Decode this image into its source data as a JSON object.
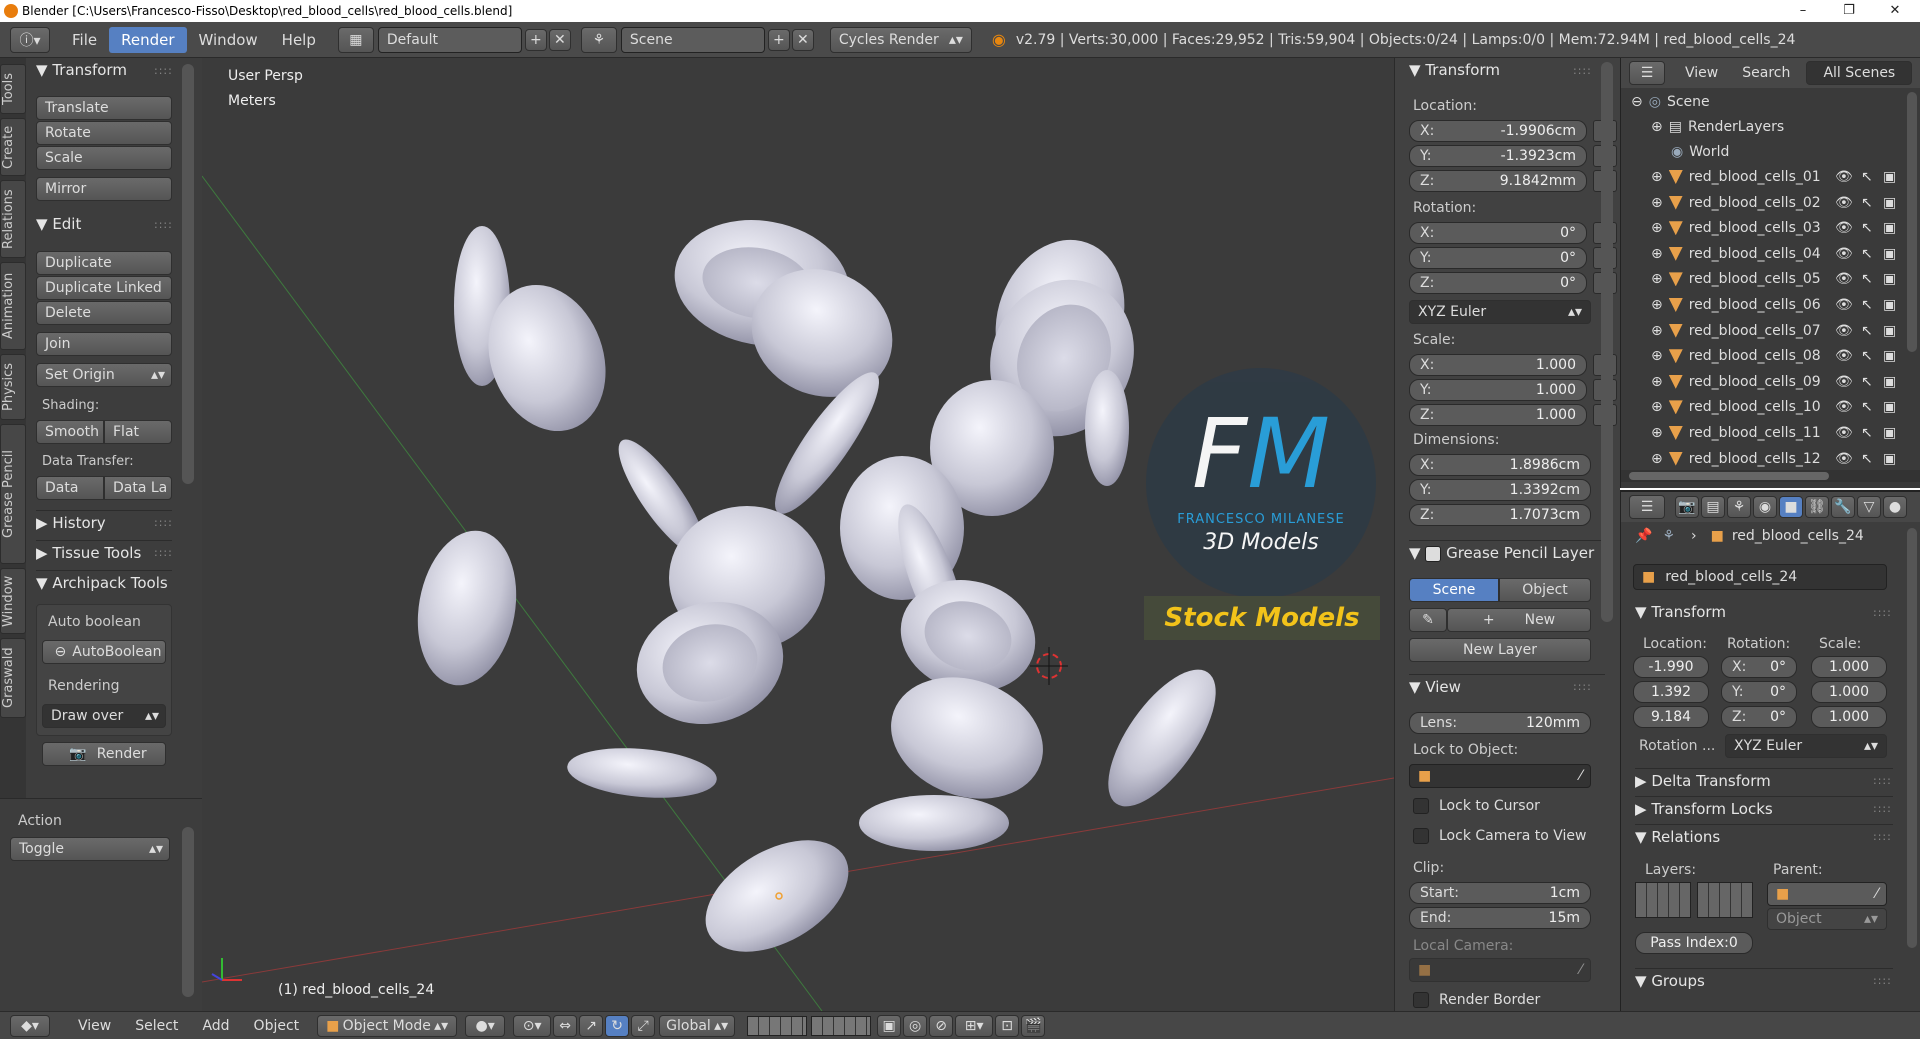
{
  "window": {
    "title": "Blender [C:\\Users\\Francesco-Fisso\\Desktop\\red_blood_cells\\red_blood_cells.blend]",
    "minimize": "–",
    "maximize": "❐",
    "close": "✕"
  },
  "topbar": {
    "menus": [
      "File",
      "Render",
      "Window",
      "Help"
    ],
    "active_menu": "Render",
    "layout": "Default",
    "scene": "Scene",
    "engine": "Cycles Render",
    "stats": "v2.79 | Verts:30,000 | Faces:29,952 | Tris:59,904 | Objects:0/24 | Lamps:0/0 | Mem:72.94M | red_blood_cells_24"
  },
  "left_tabs": [
    "Tools",
    "Create",
    "Relations",
    "Animation",
    "Physics",
    "Grease Pencil",
    "Window",
    "Graswald"
  ],
  "tools": {
    "transform_header": "Transform",
    "translate": "Translate",
    "rotate": "Rotate",
    "scale": "Scale",
    "mirror": "Mirror",
    "edit_header": "Edit",
    "duplicate": "Duplicate",
    "duplicate_linked": "Duplicate Linked",
    "delete": "Delete",
    "join": "Join",
    "set_origin": "Set Origin",
    "shading_label": "Shading:",
    "smooth": "Smooth",
    "flat": "Flat",
    "data_transfer_label": "Data Transfer:",
    "data": "Data",
    "data_la": "Data La",
    "history": "History",
    "tissue_tools": "Tissue Tools",
    "archipack": "Archipack Tools",
    "auto_boolean_label": "Auto boolean",
    "auto_boolean_btn": "AutoBoolean",
    "rendering_label": "Rendering",
    "draw_over": "Draw over",
    "render_btn": "Render",
    "action_label": "Action",
    "toggle": "Toggle"
  },
  "viewport": {
    "view_name": "User Persp",
    "units": "Meters",
    "selected": "(1) red_blood_cells_24",
    "logo_main": "FM",
    "logo_sub": "FRANCESCO MILANESE",
    "logo_models": "3D Models",
    "stock": "Stock Models"
  },
  "npanel": {
    "transform": "Transform",
    "location": "Location:",
    "loc": [
      {
        "a": "X:",
        "v": "-1.9906cm"
      },
      {
        "a": "Y:",
        "v": "-1.3923cm"
      },
      {
        "a": "Z:",
        "v": "9.1842mm"
      }
    ],
    "rotation": "Rotation:",
    "rot": [
      {
        "a": "X:",
        "v": "0°"
      },
      {
        "a": "Y:",
        "v": "0°"
      },
      {
        "a": "Z:",
        "v": "0°"
      }
    ],
    "rot_mode": "XYZ Euler",
    "scale": "Scale:",
    "scl": [
      {
        "a": "X:",
        "v": "1.000"
      },
      {
        "a": "Y:",
        "v": "1.000"
      },
      {
        "a": "Z:",
        "v": "1.000"
      }
    ],
    "dimensions": "Dimensions:",
    "dim": [
      {
        "a": "X:",
        "v": "1.8986cm"
      },
      {
        "a": "Y:",
        "v": "1.3392cm"
      },
      {
        "a": "Z:",
        "v": "1.7073cm"
      }
    ],
    "gp_layer": "Grease Pencil Layer",
    "gp_scene": "Scene",
    "gp_object": "Object",
    "gp_new": "New",
    "gp_new_layer": "New Layer",
    "view": "View",
    "lens_label": "Lens:",
    "lens_value": "120mm",
    "lock_object": "Lock to Object:",
    "lock_cursor": "Lock to Cursor",
    "lock_camera": "Lock Camera to View",
    "clip": "Clip:",
    "clip_start_label": "Start:",
    "clip_start": "1cm",
    "clip_end_label": "End:",
    "clip_end": "15m",
    "local_camera": "Local Camera:",
    "render_border": "Render Border"
  },
  "outliner": {
    "view": "View",
    "search": "Search",
    "filter": "All Scenes",
    "scene": "Scene",
    "render_layers": "RenderLayers",
    "world": "World",
    "objects": [
      "red_blood_cells_01",
      "red_blood_cells_02",
      "red_blood_cells_03",
      "red_blood_cells_04",
      "red_blood_cells_05",
      "red_blood_cells_06",
      "red_blood_cells_07",
      "red_blood_cells_08",
      "red_blood_cells_09",
      "red_blood_cells_10",
      "red_blood_cells_11",
      "red_blood_cells_12"
    ]
  },
  "properties": {
    "breadcrumb": "red_blood_cells_24",
    "object_name": "red_blood_cells_24",
    "transform": "Transform",
    "location": "Location:",
    "rotation": "Rotation:",
    "scale": "Scale:",
    "loc": [
      "-1.990",
      "1.392",
      "9.184"
    ],
    "rot": [
      {
        "a": "X:",
        "v": "0°"
      },
      {
        "a": "Y:",
        "v": "0°"
      },
      {
        "a": "Z:",
        "v": "0°"
      }
    ],
    "scl": [
      "1.000",
      "1.000",
      "1.000"
    ],
    "rotation_mode_label": "Rotation ...",
    "rotation_mode": "XYZ Euler",
    "delta": "Delta Transform",
    "locks": "Transform Locks",
    "relations": "Relations",
    "layers": "Layers:",
    "parent": "Parent:",
    "parent_type": "Object",
    "pass_index": "Pass Index:0",
    "groups": "Groups"
  },
  "bottombar": {
    "menus": [
      "View",
      "Select",
      "Add",
      "Object"
    ],
    "mode": "Object Mode",
    "orientation": "Global"
  }
}
